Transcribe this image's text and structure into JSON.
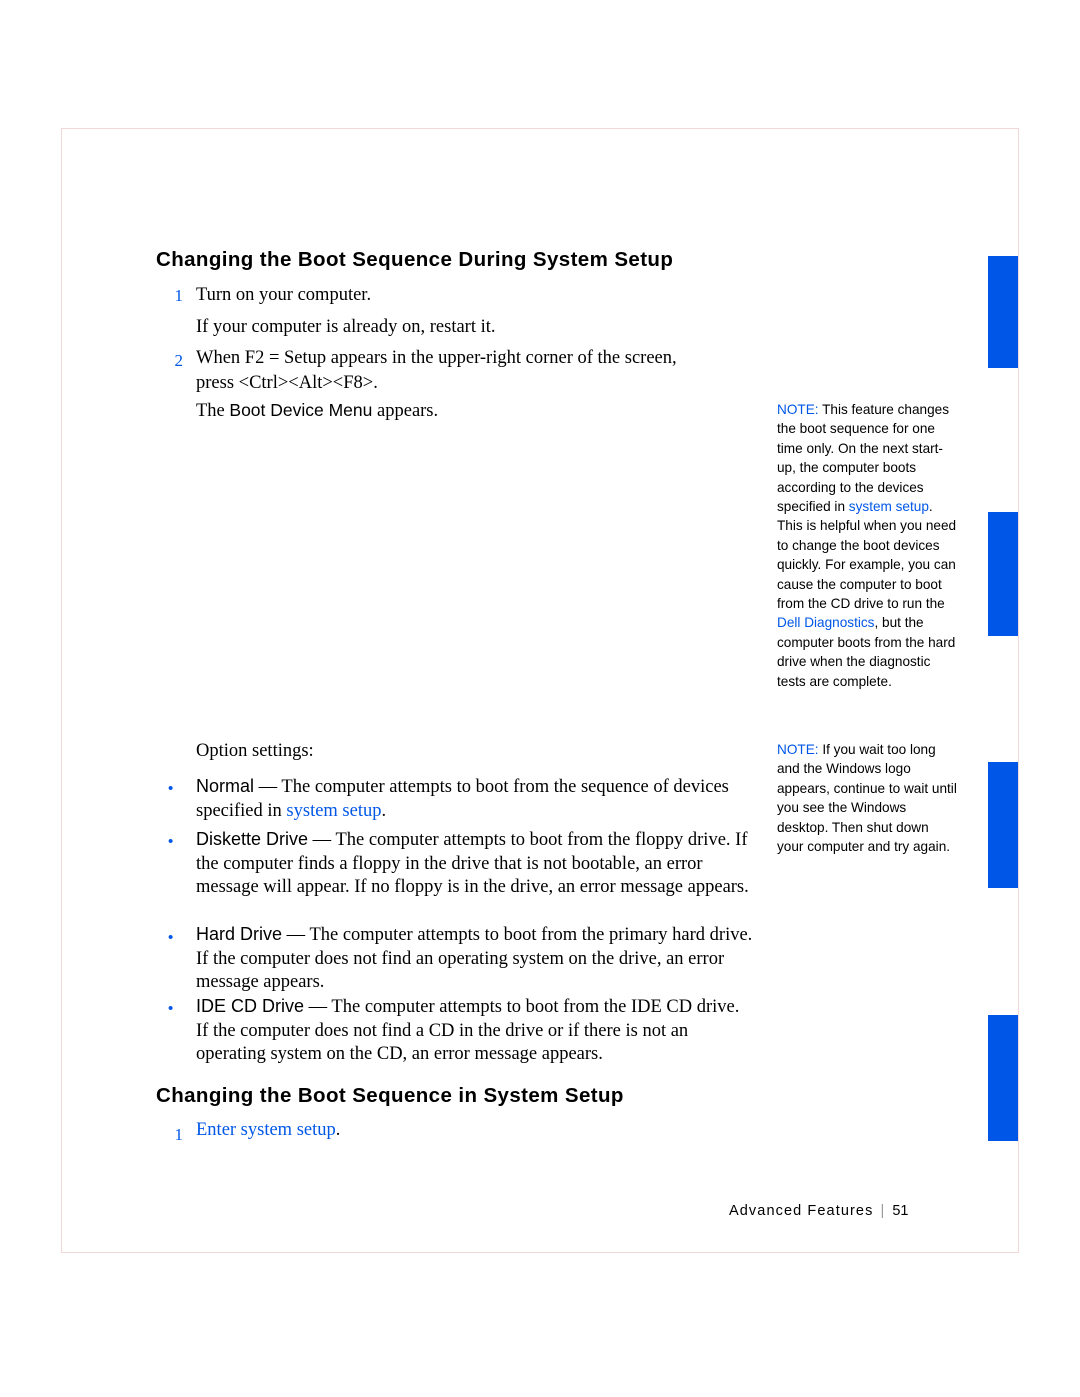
{
  "document": {
    "section_heading": "Changing the Boot Sequence During System Setup",
    "second_heading": "Changing the Boot Sequence in System Setup",
    "steps": [
      {
        "number": "1",
        "text": "Turn on your computer."
      },
      {
        "number": "2",
        "text": "When F2 = Setup appears in the upper-right corner of the screen, press <Ctrl><Alt><F8>."
      }
    ],
    "restart_line": "If your computer is already on, restart it.",
    "boot_menu_line_prefix": "The ",
    "boot_menu_line_term": "Boot Device Menu",
    "boot_menu_line_suffix": " appears.",
    "option_settings_label": "Option settings:",
    "options": [
      {
        "term": "Normal",
        "text": " — The computer attempts to boot from the sequence of devices specified in ",
        "link": "system setup",
        "tail": "."
      },
      {
        "term": "Diskette Drive",
        "text": " — The computer attempts to boot from the floppy drive. If the computer finds a floppy in the drive that is not bootable, an error message will appear. If no floppy is in the drive, an error message appears.",
        "link": "",
        "tail": ""
      },
      {
        "term": "Hard Drive",
        "text": " — The computer attempts to boot from the primary hard drive. If the computer does not find an operating system on the drive, an error message appears.",
        "link": "",
        "tail": ""
      },
      {
        "term": "IDE CD Drive",
        "text": " — The computer attempts to boot from the IDE CD drive. If the computer does not find a CD in the drive or if there is not an operating system on the CD, an error message appears.",
        "link": "",
        "tail": ""
      }
    ],
    "second_steps": [
      {
        "number": "1",
        "link": "Enter system setup",
        "tail": "."
      }
    ],
    "notes": [
      {
        "label": "NOTE:",
        "part1": " This feature changes the boot sequence for one time only. On the next start-up, the computer boots according to the devices specified in ",
        "link1": "system setup",
        "part2": ". This is helpful when you need to change the boot devices quickly. For example, you can cause the computer to boot from the CD drive to run the ",
        "link2": "Dell Diagnostics",
        "part3": ", but the computer boots from the hard drive when the diagnostic tests are complete."
      },
      {
        "label": "NOTE:",
        "part1": " If you wait too long and the Windows logo appears, continue to wait until you see the Windows desktop. Then shut down your computer and try again.",
        "link1": "",
        "part2": "",
        "link2": "",
        "part3": ""
      }
    ],
    "footer": {
      "title": "Advanced Features",
      "separator": "|",
      "page_number": "51"
    },
    "colors": {
      "accent": "#0057e7",
      "text": "#000000"
    }
  }
}
